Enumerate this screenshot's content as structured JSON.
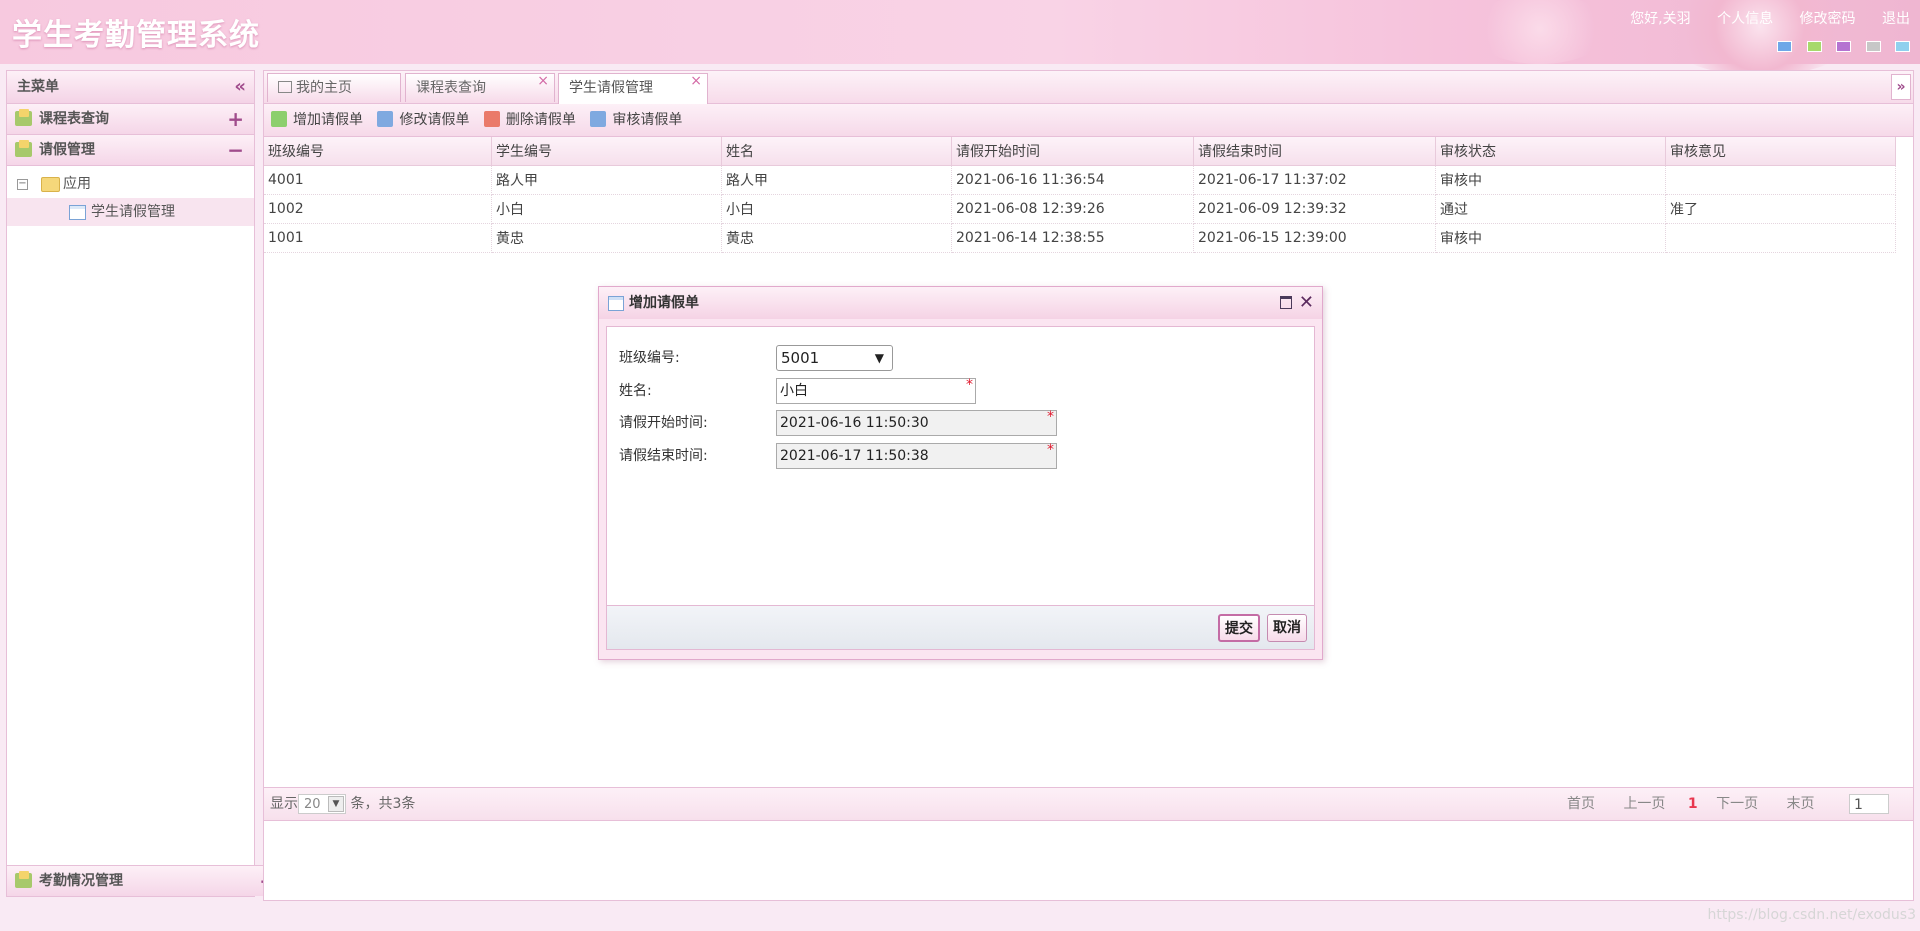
{
  "app": {
    "title": "学生考勤管理系统",
    "greeting": "您好,关羽",
    "links": [
      "个人信息",
      "修改密码",
      "退出"
    ],
    "theme_colors": [
      "#6ea7e8",
      "#a7d96b",
      "#b573d1",
      "#c7c7c7",
      "#8fd0ee"
    ]
  },
  "sidebar": {
    "title": "主菜单",
    "menus": {
      "course_query": "课程表查询",
      "leave_mgmt": "请假管理",
      "attendance_mgmt": "考勤情况管理"
    },
    "tree": {
      "root": "应用",
      "child": "学生请假管理"
    }
  },
  "tabs": [
    "我的主页",
    "课程表查询",
    "学生请假管理"
  ],
  "toolbar": {
    "add": "增加请假单",
    "edit": "修改请假单",
    "delete": "删除请假单",
    "review": "审核请假单"
  },
  "grid": {
    "columns": [
      "班级编号",
      "学生编号",
      "姓名",
      "请假开始时间",
      "请假结束时间",
      "审核状态",
      "审核意见"
    ],
    "rows": [
      [
        "4001",
        "路人甲",
        "路人甲",
        "2021-06-16 11:36:54",
        "2021-06-17 11:37:02",
        "审核中",
        ""
      ],
      [
        "1002",
        "小白",
        "小白",
        "2021-06-08 12:39:26",
        "2021-06-09 12:39:32",
        "通过",
        "准了"
      ],
      [
        "1001",
        "黄忠",
        "黄忠",
        "2021-06-14 12:38:55",
        "2021-06-15 12:39:00",
        "审核中",
        ""
      ]
    ]
  },
  "pager": {
    "show_label": "显示",
    "page_size": "20",
    "summary": "条，共3条",
    "first": "首页",
    "prev": "上一页",
    "current": "1",
    "next": "下一页",
    "last": "末页",
    "page_input": "1"
  },
  "dialog": {
    "title": "增加请假单",
    "fields": {
      "class_label": "班级编号:",
      "class_value": "5001",
      "name_label": "姓名:",
      "name_value": "小白",
      "start_label": "请假开始时间:",
      "start_value": "2021-06-16 11:50:30",
      "end_label": "请假结束时间:",
      "end_value": "2021-06-17 11:50:38"
    },
    "submit": "提交",
    "cancel": "取消"
  },
  "watermark": "https://blog.csdn.net/exodus3"
}
